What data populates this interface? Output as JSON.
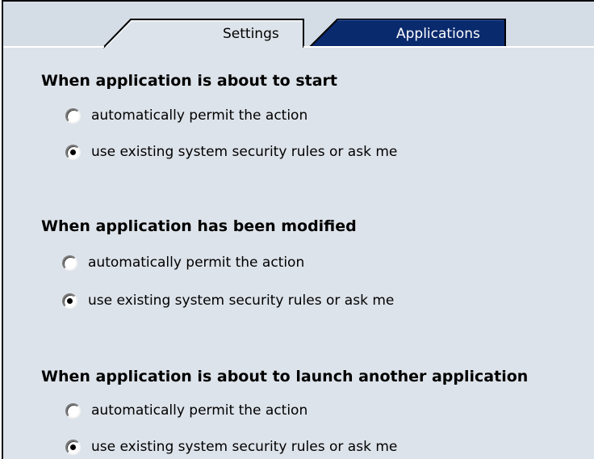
{
  "tabs": [
    {
      "label": "Settings",
      "active": true
    },
    {
      "label": "Applications",
      "active": false
    }
  ],
  "sections": [
    {
      "title": "When application is about to start",
      "options": [
        {
          "label": "automatically permit the action",
          "checked": false
        },
        {
          "label": "use existing system security rules or ask me",
          "checked": true
        }
      ]
    },
    {
      "title": "When application has been modified",
      "options": [
        {
          "label": "automatically permit the action",
          "checked": false
        },
        {
          "label": "use existing system security rules or ask me",
          "checked": true
        }
      ]
    },
    {
      "title": "When application is about to launch another application",
      "options": [
        {
          "label": "automatically permit the action",
          "checked": false
        },
        {
          "label": "use existing system security rules or ask me",
          "checked": true
        }
      ]
    }
  ],
  "colors": {
    "panel_bg": "#dde3ea",
    "active_tab_bg": "#dde3ea",
    "inactive_tab_bg": "#0a2a6e",
    "inactive_tab_text": "#ffffff"
  }
}
